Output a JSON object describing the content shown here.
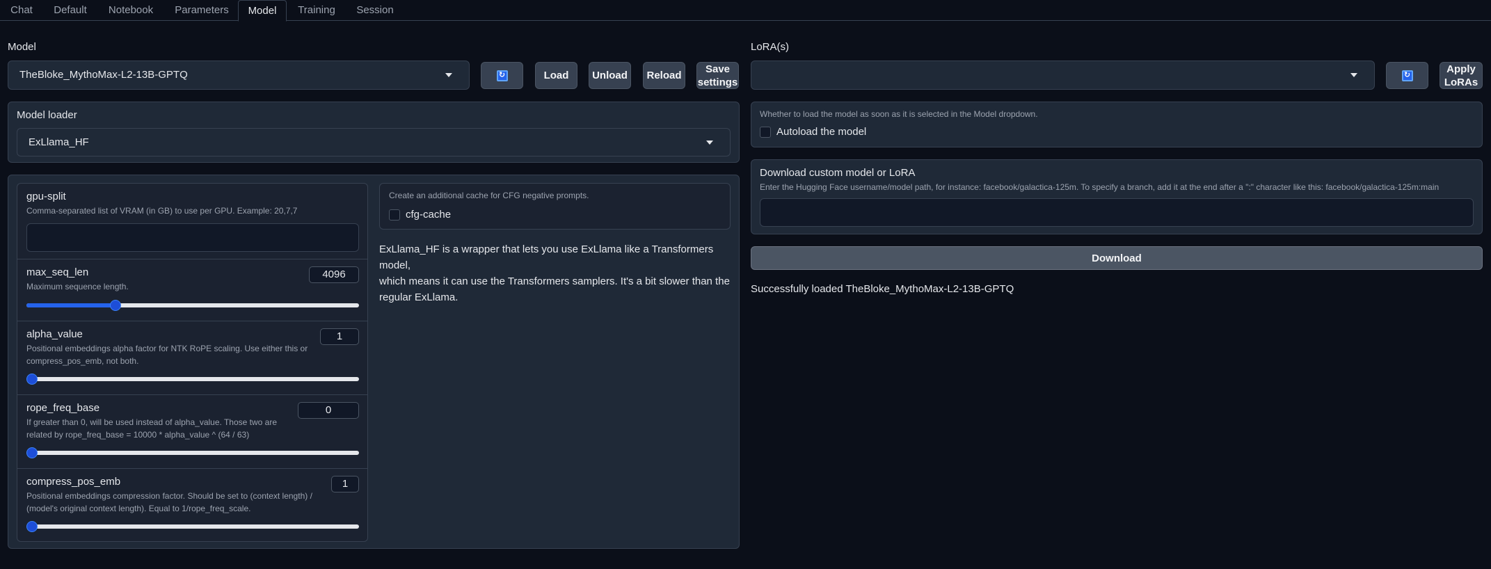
{
  "tabs": [
    {
      "label": "Chat"
    },
    {
      "label": "Default"
    },
    {
      "label": "Notebook"
    },
    {
      "label": "Parameters"
    },
    {
      "label": "Model",
      "active": true
    },
    {
      "label": "Training"
    },
    {
      "label": "Session"
    }
  ],
  "model": {
    "label": "Model",
    "selected": "TheBloke_MythoMax-L2-13B-GPTQ",
    "refresh_icon": "refresh-icon",
    "buttons": {
      "load": "Load",
      "unload": "Unload",
      "reload": "Reload",
      "save_line1": "Save",
      "save_line2": "settings"
    }
  },
  "loader": {
    "label": "Model loader",
    "selected": "ExLlama_HF"
  },
  "params": {
    "gpu_split": {
      "label": "gpu-split",
      "info": "Comma-separated list of VRAM (in GB) to use per GPU. Example: 20,7,7",
      "value": ""
    },
    "max_seq_len": {
      "label": "max_seq_len",
      "info": "Maximum sequence length.",
      "value": "4096",
      "fraction": 0.26
    },
    "alpha_value": {
      "label": "alpha_value",
      "info_line1": "Positional embeddings alpha factor for NTK RoPE scaling. Use either this or",
      "info_line2": "compress_pos_emb, not both.",
      "value": "1",
      "fraction": 0
    },
    "rope_freq_base": {
      "label": "rope_freq_base",
      "info_line1": "If greater than 0, will be used instead of alpha_value. Those two are",
      "info_line2": "related by rope_freq_base = 10000 * alpha_value ^ (64 / 63)",
      "value": "0",
      "fraction": 0
    },
    "compress_pos_emb": {
      "label": "compress_pos_emb",
      "info_line1": "Positional embeddings compression factor. Should be set to (context length) /",
      "info_line2": "(model's original context length). Equal to 1/rope_freq_scale.",
      "value": "1",
      "fraction": 0
    }
  },
  "cfg_cache": {
    "info": "Create an additional cache for CFG negative prompts.",
    "label": "cfg-cache"
  },
  "loader_description": {
    "line1": "ExLlama_HF is a wrapper that lets you use ExLlama like a Transformers model,",
    "line2": "which means it can use the Transformers samplers. It's a bit slower than the",
    "line3": "regular ExLlama."
  },
  "lora": {
    "label": "LoRA(s)",
    "selected": "",
    "apply_line1": "Apply",
    "apply_line2": "LoRAs"
  },
  "autoload": {
    "info": "Whether to load the model as soon as it is selected in the Model dropdown.",
    "label": "Autoload the model"
  },
  "download": {
    "title": "Download custom model or LoRA",
    "info": "Enter the Hugging Face username/model path, for instance: facebook/galactica-125m. To specify a branch, add it at the end after a \":\" character like this: facebook/galactica-125m:main",
    "value": "",
    "button": "Download"
  },
  "status": "Successfully loaded TheBloke_MythoMax-L2-13B-GPTQ"
}
